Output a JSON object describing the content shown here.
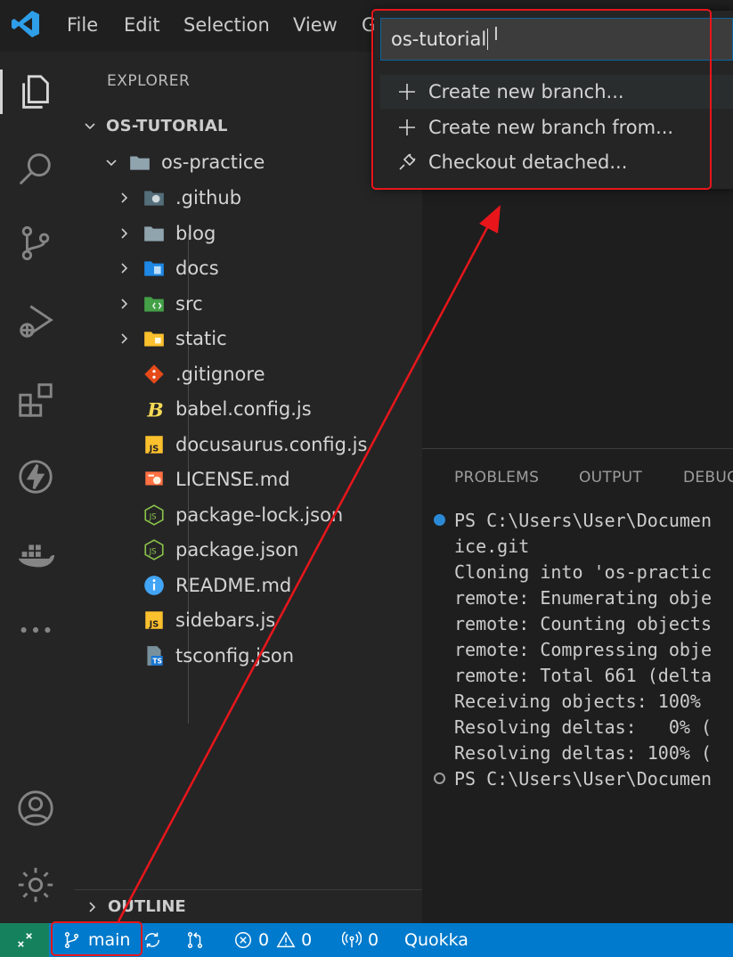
{
  "menu": {
    "file": "File",
    "edit": "Edit",
    "selection": "Selection",
    "view": "View",
    "go_partial": "G"
  },
  "activity_bar": [
    "explorer-icon",
    "search-icon",
    "source-control-icon",
    "run-debug-icon",
    "extensions-icon",
    "lightning-icon",
    "docker-icon",
    "more-icon",
    "account-icon",
    "gear-icon"
  ],
  "sidebar": {
    "title": "EXPLORER",
    "root": "OS-TUTORIAL",
    "folder": "os-practice",
    "items": [
      {
        "label": ".github",
        "icon": "github-folder-icon"
      },
      {
        "label": "blog",
        "icon": "folder-icon"
      },
      {
        "label": "docs",
        "icon": "docs-folder-icon"
      },
      {
        "label": "src",
        "icon": "src-folder-icon"
      },
      {
        "label": "static",
        "icon": "static-folder-icon"
      },
      {
        "label": ".gitignore",
        "icon": "git-icon"
      },
      {
        "label": "babel.config.js",
        "icon": "babel-icon"
      },
      {
        "label": "docusaurus.config.js",
        "icon": "js-icon"
      },
      {
        "label": "LICENSE.md",
        "icon": "license-icon"
      },
      {
        "label": "package-lock.json",
        "icon": "nodejs-icon"
      },
      {
        "label": "package.json",
        "icon": "nodejs-icon"
      },
      {
        "label": "README.md",
        "icon": "info-icon"
      },
      {
        "label": "sidebars.js",
        "icon": "js-icon"
      },
      {
        "label": "tsconfig.json",
        "icon": "ts-icon"
      }
    ],
    "outline": "OUTLINE"
  },
  "quick_pick": {
    "input_value": "os-tutorial",
    "items": [
      "Create new branch...",
      "Create new branch from...",
      "Checkout detached..."
    ]
  },
  "panel": {
    "tabs": [
      "PROBLEMS",
      "OUTPUT",
      "DEBUG"
    ],
    "terminal_lines": [
      "PS C:\\Users\\User\\Documen",
      "ice.git",
      "Cloning into 'os-practic",
      "remote: Enumerating obje",
      "remote: Counting objects",
      "remote: Compressing obje",
      "remote: Total 661 (delta",
      "Receiving objects: 100%",
      "Resolving deltas:   0% (",
      "Resolving deltas: 100% (",
      "PS C:\\Users\\User\\Documen"
    ]
  },
  "status_bar": {
    "branch": "main",
    "errors": "0",
    "warnings": "0",
    "ports": "0",
    "quokka": "Quokka"
  },
  "colors": {
    "accent": "#007acc",
    "remote": "#16825d",
    "annotation": "#e8161b"
  }
}
